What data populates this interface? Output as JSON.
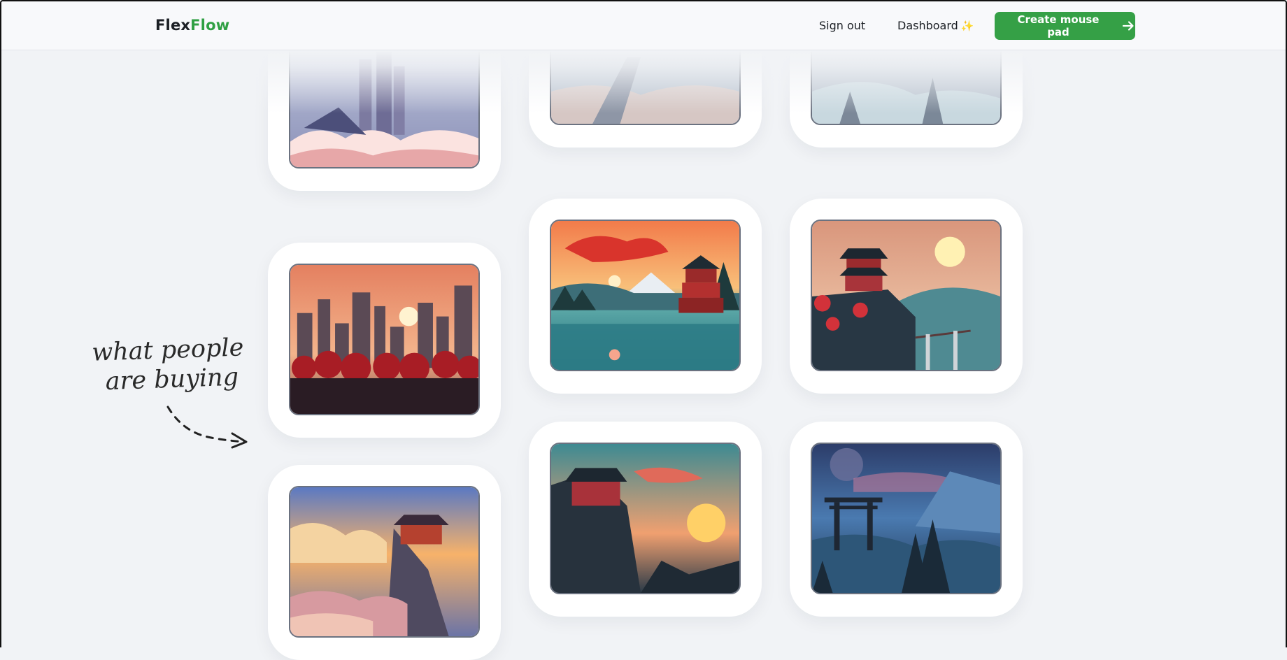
{
  "brand": {
    "part1": "Flex",
    "part2": "Flow"
  },
  "nav": {
    "sign_out": "Sign out",
    "dashboard": "Dashboard",
    "dashboard_icon": "sparkles-icon",
    "cta": "Create mouse pad",
    "cta_icon": "arrow-right-icon"
  },
  "annotation": {
    "line1": "what people",
    "line2": "are buying"
  },
  "gallery": {
    "items": [
      {
        "id": "city-clouds-fog"
      },
      {
        "id": "railway-mist"
      },
      {
        "id": "forest-mist"
      },
      {
        "id": "red-city-sunset"
      },
      {
        "id": "pagoda-lake-fuji"
      },
      {
        "id": "cliff-temple-bridge"
      },
      {
        "id": "cloud-temple-sunset"
      },
      {
        "id": "cliff-house-sun"
      },
      {
        "id": "torii-moon-valley"
      }
    ]
  },
  "colors": {
    "accent": "#35a046",
    "brand_green": "#2fa043"
  }
}
